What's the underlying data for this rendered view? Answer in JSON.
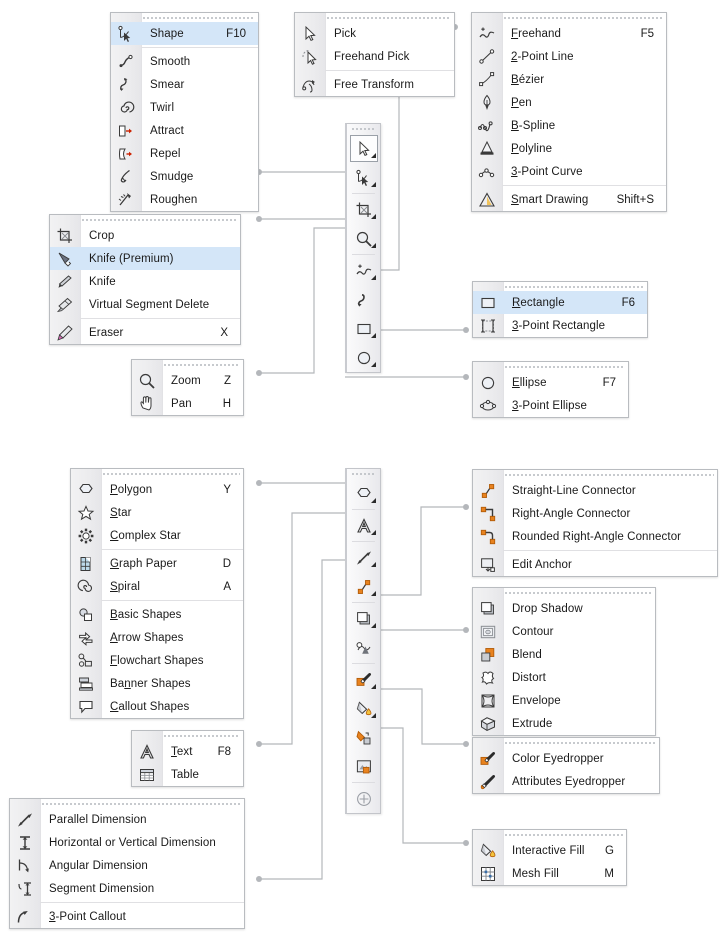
{
  "page": {
    "title": "CorelDRAW Toolbox Flyouts Reference",
    "accent_selected": "#d4e6f8",
    "accent_orange": "#e8821e",
    "wire_color": "#b4b7bb",
    "panel_border": "#b9bcc0"
  },
  "menus": {
    "shape_edit": {
      "name": "shape-edit-flyout",
      "items": [
        {
          "label": "Shape",
          "accel": "F10",
          "icon": "shape-tool-icon",
          "selected": true,
          "underline": ""
        },
        {
          "label": "Smooth",
          "accel": "",
          "icon": "smooth-tool-icon"
        },
        {
          "label": "Smear",
          "accel": "",
          "icon": "smear-tool-icon"
        },
        {
          "label": "Twirl",
          "accel": "",
          "icon": "twirl-tool-icon"
        },
        {
          "label": "Attract",
          "accel": "",
          "icon": "attract-tool-icon"
        },
        {
          "label": "Repel",
          "accel": "",
          "icon": "repel-tool-icon"
        },
        {
          "label": "Smudge",
          "accel": "",
          "icon": "smudge-tool-icon"
        },
        {
          "label": "Roughen",
          "accel": "",
          "icon": "roughen-tool-icon"
        }
      ],
      "separators_after": [
        0
      ]
    },
    "pick": {
      "name": "pick-flyout",
      "items": [
        {
          "label": "Pick",
          "accel": "",
          "icon": "pick-tool-icon"
        },
        {
          "label": "Freehand Pick",
          "accel": "",
          "icon": "freehand-pick-tool-icon"
        },
        {
          "label": "Free Transform",
          "accel": "",
          "icon": "free-transform-tool-icon"
        }
      ],
      "separators_after": [
        1
      ]
    },
    "curve": {
      "name": "curve-flyout",
      "items": [
        {
          "label": "Freehand",
          "accel": "F5",
          "icon": "freehand-tool-icon",
          "underline": "F"
        },
        {
          "label": "2-Point Line",
          "accel": "",
          "icon": "two-point-line-tool-icon",
          "underline": "2"
        },
        {
          "label": "Bézier",
          "accel": "",
          "icon": "bezier-tool-icon",
          "underline": "B"
        },
        {
          "label": "Pen",
          "accel": "",
          "icon": "pen-tool-icon",
          "underline": "P"
        },
        {
          "label": "B-Spline",
          "accel": "",
          "icon": "b-spline-tool-icon",
          "underline": "B"
        },
        {
          "label": "Polyline",
          "accel": "",
          "icon": "polyline-tool-icon",
          "underline": "P"
        },
        {
          "label": "3-Point Curve",
          "accel": "",
          "icon": "three-point-curve-tool-icon",
          "underline": "3"
        },
        {
          "label": "Smart Drawing",
          "accel": "Shift+S",
          "icon": "smart-drawing-tool-icon",
          "underline": "S"
        }
      ],
      "separators_after": [
        6
      ]
    },
    "crop": {
      "name": "crop-flyout",
      "items": [
        {
          "label": "Crop",
          "accel": "",
          "icon": "crop-tool-icon"
        },
        {
          "label": "Knife (Premium)",
          "accel": "",
          "icon": "knife-premium-tool-icon",
          "selected": true
        },
        {
          "label": "Knife",
          "accel": "",
          "icon": "knife-tool-icon"
        },
        {
          "label": "Virtual Segment Delete",
          "accel": "",
          "icon": "virtual-segment-delete-tool-icon"
        },
        {
          "label": "Eraser",
          "accel": "X",
          "icon": "eraser-tool-icon"
        }
      ],
      "separators_after": [
        3
      ]
    },
    "rectangle": {
      "name": "rectangle-flyout",
      "items": [
        {
          "label": "Rectangle",
          "accel": "F6",
          "icon": "rectangle-tool-icon",
          "selected_box": true,
          "underline": "R"
        },
        {
          "label": "3-Point Rectangle",
          "accel": "",
          "icon": "three-point-rectangle-tool-icon",
          "underline": "3"
        }
      ],
      "separators_after": []
    },
    "zoom": {
      "name": "zoom-flyout",
      "items": [
        {
          "label": "Zoom",
          "accel": "Z",
          "icon": "zoom-tool-icon"
        },
        {
          "label": "Pan",
          "accel": "H",
          "icon": "pan-tool-icon"
        }
      ],
      "separators_after": []
    },
    "ellipse": {
      "name": "ellipse-flyout",
      "items": [
        {
          "label": "Ellipse",
          "accel": "F7",
          "icon": "ellipse-tool-icon",
          "underline": "E"
        },
        {
          "label": "3-Point Ellipse",
          "accel": "",
          "icon": "three-point-ellipse-tool-icon",
          "underline": "3"
        }
      ],
      "separators_after": []
    },
    "object": {
      "name": "object-shapes-flyout",
      "items": [
        {
          "label": "Polygon",
          "accel": "Y",
          "icon": "polygon-tool-icon",
          "underline": "P"
        },
        {
          "label": "Star",
          "accel": "",
          "icon": "star-tool-icon",
          "underline": "S"
        },
        {
          "label": "Complex Star",
          "accel": "",
          "icon": "complex-star-tool-icon",
          "underline": "C"
        },
        {
          "label": "Graph Paper",
          "accel": "D",
          "icon": "graph-paper-tool-icon",
          "underline": "G"
        },
        {
          "label": "Spiral",
          "accel": "A",
          "icon": "spiral-tool-icon",
          "underline": "S"
        },
        {
          "label": "Basic Shapes",
          "accel": "",
          "icon": "basic-shapes-tool-icon",
          "underline": "B"
        },
        {
          "label": "Arrow Shapes",
          "accel": "",
          "icon": "arrow-shapes-tool-icon",
          "underline": "A"
        },
        {
          "label": "Flowchart Shapes",
          "accel": "",
          "icon": "flowchart-shapes-tool-icon",
          "underline": "F"
        },
        {
          "label": "Banner Shapes",
          "accel": "",
          "icon": "banner-shapes-tool-icon",
          "underline": "n"
        },
        {
          "label": "Callout Shapes",
          "accel": "",
          "icon": "callout-shapes-tool-icon",
          "underline": "C"
        }
      ],
      "separators_after": [
        2,
        4
      ]
    },
    "connector": {
      "name": "connector-flyout",
      "items": [
        {
          "label": "Straight-Line Connector",
          "accel": "",
          "icon": "straight-line-connector-icon"
        },
        {
          "label": "Right-Angle Connector",
          "accel": "",
          "icon": "right-angle-connector-icon"
        },
        {
          "label": "Rounded Right-Angle Connector",
          "accel": "",
          "icon": "rounded-right-angle-connector-icon"
        },
        {
          "label": "Edit Anchor",
          "accel": "",
          "icon": "edit-anchor-tool-icon"
        }
      ],
      "separators_after": [
        2
      ]
    },
    "effects": {
      "name": "effects-flyout",
      "items": [
        {
          "label": "Drop Shadow",
          "accel": "",
          "icon": "drop-shadow-tool-icon"
        },
        {
          "label": "Contour",
          "accel": "",
          "icon": "contour-tool-icon"
        },
        {
          "label": "Blend",
          "accel": "",
          "icon": "blend-tool-icon"
        },
        {
          "label": "Distort",
          "accel": "",
          "icon": "distort-tool-icon"
        },
        {
          "label": "Envelope",
          "accel": "",
          "icon": "envelope-tool-icon"
        },
        {
          "label": "Extrude",
          "accel": "",
          "icon": "extrude-tool-icon"
        }
      ],
      "separators_after": []
    },
    "text": {
      "name": "text-flyout",
      "items": [
        {
          "label": "Text",
          "accel": "F8",
          "icon": "text-tool-icon",
          "underline": "T"
        },
        {
          "label": "Table",
          "accel": "",
          "icon": "table-tool-icon"
        }
      ],
      "separators_after": []
    },
    "eyedropper": {
      "name": "eyedropper-flyout",
      "items": [
        {
          "label": "Color Eyedropper",
          "accel": "",
          "icon": "color-eyedropper-tool-icon"
        },
        {
          "label": "Attributes Eyedropper",
          "accel": "",
          "icon": "attributes-eyedropper-tool-icon"
        }
      ],
      "separators_after": []
    },
    "fill": {
      "name": "interactive-fill-flyout",
      "items": [
        {
          "label": "Interactive Fill",
          "accel": "G",
          "icon": "interactive-fill-tool-icon"
        },
        {
          "label": "Mesh Fill",
          "accel": "M",
          "icon": "mesh-fill-tool-icon"
        }
      ],
      "separators_after": []
    },
    "dimension": {
      "name": "dimension-flyout",
      "items": [
        {
          "label": "Parallel Dimension",
          "accel": "",
          "icon": "parallel-dimension-tool-icon"
        },
        {
          "label": "Horizontal or Vertical Dimension",
          "accel": "",
          "icon": "horizontal-vertical-dimension-tool-icon"
        },
        {
          "label": "Angular Dimension",
          "accel": "",
          "icon": "angular-dimension-tool-icon"
        },
        {
          "label": "Segment Dimension",
          "accel": "",
          "icon": "segment-dimension-tool-icon"
        },
        {
          "label": "3-Point Callout",
          "accel": "",
          "icon": "three-point-callout-tool-icon",
          "underline": "3"
        }
      ],
      "separators_after": [
        3
      ]
    }
  },
  "toolbox_top": {
    "name": "toolbox-upper",
    "buttons": [
      {
        "icon": "pick-tool-icon",
        "active": true,
        "arrow": true
      },
      {
        "icon": "shape-tool-icon",
        "active": false,
        "arrow": true
      },
      {
        "icon": "crop-tool-icon",
        "active": false,
        "arrow": true
      },
      {
        "icon": "zoom-tool-icon",
        "active": false,
        "arrow": true
      },
      {
        "icon": "freehand-tool-icon",
        "active": false,
        "arrow": true
      },
      {
        "icon": "artistic-media-tool-icon",
        "active": false,
        "arrow": false
      },
      {
        "icon": "rectangle-tool-icon",
        "active": false,
        "arrow": true
      },
      {
        "icon": "ellipse-tool-icon",
        "active": false,
        "arrow": true
      }
    ],
    "separators_after": [
      1,
      3
    ]
  },
  "toolbox_bottom": {
    "name": "toolbox-lower",
    "buttons": [
      {
        "icon": "polygon-tool-icon",
        "active": false,
        "arrow": true
      },
      {
        "icon": "text-tool-icon",
        "active": false,
        "arrow": true
      },
      {
        "icon": "parallel-dimension-tool-icon",
        "active": false,
        "arrow": true
      },
      {
        "icon": "straight-line-connector-icon",
        "active": false,
        "arrow": true
      },
      {
        "icon": "drop-shadow-tool-icon",
        "active": false,
        "arrow": true
      },
      {
        "icon": "transparency-tool-icon",
        "active": false,
        "arrow": false
      },
      {
        "icon": "color-eyedropper-tool-icon",
        "active": false,
        "arrow": true
      },
      {
        "icon": "interactive-fill-tool-icon",
        "active": false,
        "arrow": true
      },
      {
        "icon": "smart-fill-tool-icon",
        "active": false,
        "arrow": false
      },
      {
        "icon": "insert-object-tool-icon",
        "active": false,
        "arrow": false
      },
      {
        "icon": "add-tool-icon",
        "active": false,
        "arrow": false
      }
    ],
    "separators_after": [
      0,
      1,
      3,
      5,
      9
    ]
  }
}
